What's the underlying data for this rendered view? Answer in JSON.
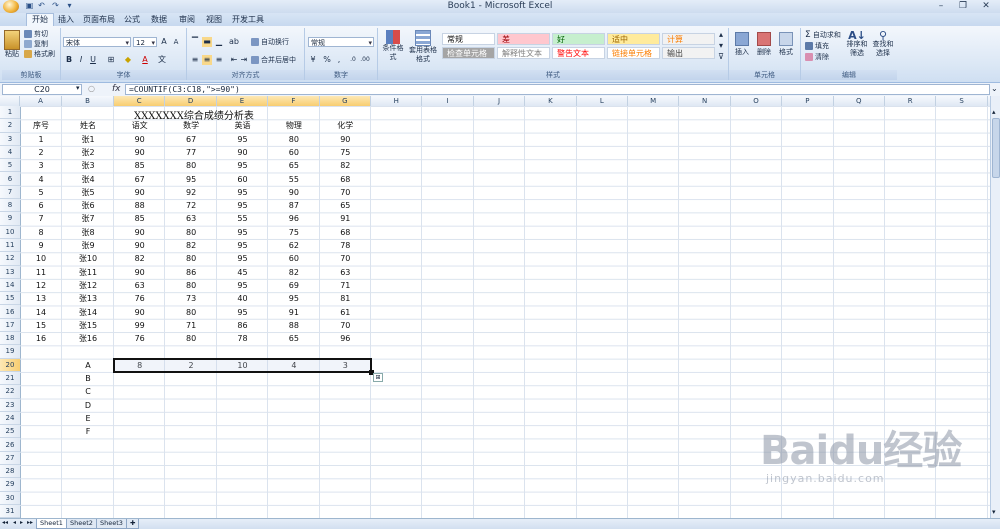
{
  "window": {
    "title": "Book1 - Microsoft Excel"
  },
  "tabs": [
    "开始",
    "插入",
    "页面布局",
    "公式",
    "数据",
    "审阅",
    "视图",
    "开发工具"
  ],
  "clipboard": {
    "paste": "粘贴",
    "cut": "剪切",
    "copy": "复制",
    "format_painter": "格式刷",
    "label": "剪贴板"
  },
  "font": {
    "name": "宋体",
    "size": "12",
    "label": "字体"
  },
  "alignment": {
    "wrap": "自动换行",
    "merge": "合并后居中",
    "label": "对齐方式"
  },
  "number": {
    "format": "常规",
    "label": "数字"
  },
  "styles": {
    "conditional": "条件格式",
    "table": "套用表格格式",
    "cells": [
      {
        "text": "常规",
        "bg": "#ffffff",
        "fg": "#111111"
      },
      {
        "text": "差",
        "bg": "#ffc7ce",
        "fg": "#9c0006"
      },
      {
        "text": "好",
        "bg": "#c6efce",
        "fg": "#006100"
      },
      {
        "text": "适中",
        "bg": "#ffeb9c",
        "fg": "#9c6500"
      },
      {
        "text": "计算",
        "bg": "#f2f2f2",
        "fg": "#fa7d00"
      },
      {
        "text": "检查单元格",
        "bg": "#a5a5a5",
        "fg": "#ffffff"
      },
      {
        "text": "解释性文本",
        "bg": "#ffffff",
        "fg": "#7f7f7f"
      },
      {
        "text": "警告文本",
        "bg": "#ffffff",
        "fg": "#ff0000"
      },
      {
        "text": "链接单元格",
        "bg": "#ffffff",
        "fg": "#fa7d00"
      },
      {
        "text": "输出",
        "bg": "#f2f2f2",
        "fg": "#3f3f3f"
      }
    ],
    "label": "样式"
  },
  "cells_group": {
    "insert": "插入",
    "delete": "删除",
    "format": "格式",
    "label": "单元格"
  },
  "editing": {
    "autosum": "自动求和",
    "fill": "填充",
    "clear": "清除",
    "sort": "排序和筛选",
    "find": "查找和选择",
    "label": "编辑"
  },
  "formula_bar": {
    "name_box": "C20",
    "fx": "fx",
    "formula": "=COUNTIF(C3:C18,\">=90\")"
  },
  "columns": [
    "A",
    "B",
    "C",
    "D",
    "E",
    "F",
    "G",
    "H",
    "I",
    "J",
    "K",
    "L",
    "M",
    "N",
    "O",
    "P",
    "Q",
    "R",
    "S"
  ],
  "rows": [
    "1",
    "2",
    "3",
    "4",
    "5",
    "6",
    "7",
    "8",
    "9",
    "10",
    "11",
    "12",
    "13",
    "14",
    "15",
    "16",
    "17",
    "18",
    "19",
    "20",
    "21",
    "22",
    "23",
    "24",
    "25",
    "26",
    "27",
    "28",
    "29",
    "30",
    "31"
  ],
  "sheet": {
    "title": "XXXXXXX综合成绩分析表",
    "headers": [
      "序号",
      "姓名",
      "语文",
      "数学",
      "英语",
      "物理",
      "化学"
    ],
    "data": [
      [
        "1",
        "张1",
        "90",
        "67",
        "95",
        "80",
        "90"
      ],
      [
        "2",
        "张2",
        "90",
        "77",
        "90",
        "60",
        "75"
      ],
      [
        "3",
        "张3",
        "85",
        "80",
        "95",
        "65",
        "82"
      ],
      [
        "4",
        "张4",
        "67",
        "95",
        "60",
        "55",
        "68"
      ],
      [
        "5",
        "张5",
        "90",
        "92",
        "95",
        "90",
        "70"
      ],
      [
        "6",
        "张6",
        "88",
        "72",
        "95",
        "87",
        "65"
      ],
      [
        "7",
        "张7",
        "85",
        "63",
        "55",
        "96",
        "91"
      ],
      [
        "8",
        "张8",
        "90",
        "80",
        "95",
        "75",
        "68"
      ],
      [
        "9",
        "张9",
        "90",
        "82",
        "95",
        "62",
        "78"
      ],
      [
        "10",
        "张10",
        "82",
        "80",
        "95",
        "60",
        "70"
      ],
      [
        "11",
        "张11",
        "90",
        "86",
        "45",
        "82",
        "63"
      ],
      [
        "12",
        "张12",
        "63",
        "80",
        "95",
        "69",
        "71"
      ],
      [
        "13",
        "张13",
        "76",
        "73",
        "40",
        "95",
        "81"
      ],
      [
        "14",
        "张14",
        "90",
        "80",
        "95",
        "91",
        "61"
      ],
      [
        "15",
        "张15",
        "99",
        "71",
        "86",
        "88",
        "70"
      ],
      [
        "16",
        "张16",
        "76",
        "80",
        "78",
        "65",
        "96"
      ]
    ],
    "grade_labels": [
      "A",
      "B",
      "C",
      "D",
      "E",
      "F"
    ],
    "grade_A_counts": [
      "8",
      "2",
      "10",
      "4",
      "3"
    ]
  },
  "sheet_tabs": [
    "Sheet1",
    "Sheet2",
    "Sheet3"
  ],
  "watermark": {
    "big": "Baidu经验",
    "small": "jingyan.baidu.com"
  }
}
